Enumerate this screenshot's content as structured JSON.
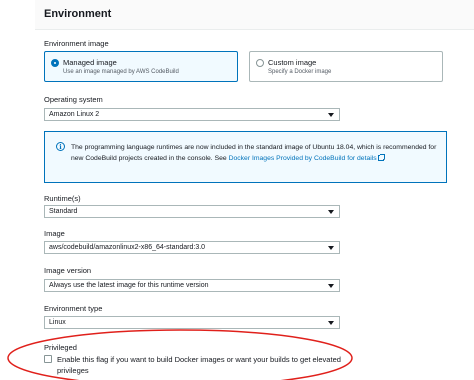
{
  "section": {
    "title": "Environment"
  },
  "environment_image": {
    "label": "Environment image",
    "options": [
      {
        "title": "Managed image",
        "description": "Use an image managed by AWS CodeBuild",
        "selected": true
      },
      {
        "title": "Custom image",
        "description": "Specify a Docker image",
        "selected": false
      }
    ]
  },
  "operating_system": {
    "label": "Operating system",
    "value": "Amazon Linux 2"
  },
  "info": {
    "text": "The programming language runtimes are now included in the standard image of Ubuntu 18.04, which is recommended for new CodeBuild projects created in the console. See ",
    "link": "Docker Images Provided by CodeBuild for details",
    "suffix": "."
  },
  "runtime": {
    "label": "Runtime(s)",
    "value": "Standard"
  },
  "image": {
    "label": "Image",
    "value": "aws/codebuild/amazonlinux2-x86_64-standard:3.0"
  },
  "image_version": {
    "label": "Image version",
    "value": "Always use the latest image for this runtime version"
  },
  "environment_type": {
    "label": "Environment type",
    "value": "Linux"
  },
  "privileged": {
    "label": "Privileged",
    "checkbox_text": "Enable this flag if you want to build Docker images or want your builds to get elevated privileges",
    "checked": false
  },
  "colors": {
    "accent": "#0073bb",
    "annotation": "#e0201b",
    "info_bg": "#f1faff"
  }
}
